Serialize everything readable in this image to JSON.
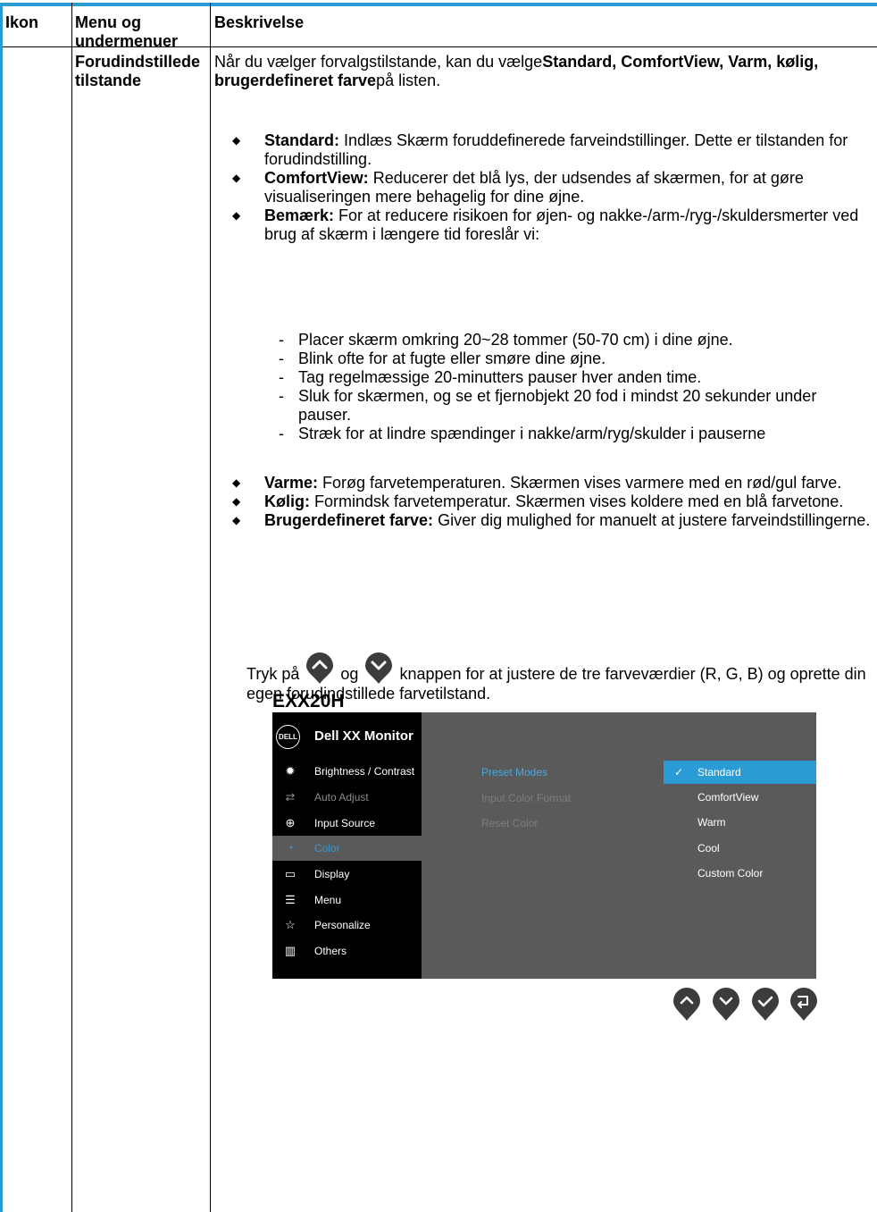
{
  "header": {
    "col1": "Ikon",
    "col2": "Menu og undermenuer",
    "col3": "Beskrivelse"
  },
  "row": {
    "menu": "Forudindstillede tilstande",
    "intro": {
      "part1": "Når du vælger forvalgstilstande, kan du vælge",
      "bold": "Standard, ComfortView, Varm, kølig, brugerdefineret farve",
      "part2": "på listen."
    },
    "bullets_a": [
      {
        "term": "Standard:",
        "text": " Indlæs Skærm foruddefinerede farveindstillinger. Dette er tilstanden for forudindstilling."
      },
      {
        "term": "ComfortView:",
        "text": " Reducerer det blå lys, der udsendes af skærmen, for at gøre visualiseringen mere behagelig for dine øjne."
      },
      {
        "term": "Bemærk:",
        "text": " For at reducere risikoen for øjen- og nakke-/arm-/ryg-/skuldersmerter ved brug af skærm i længere tid foreslår vi:"
      }
    ],
    "tips": [
      "Placer skærm omkring 20~28 tommer (50-70 cm) i dine øjne.",
      "Blink ofte for at fugte eller smøre dine øjne.",
      "Tag regelmæssige 20-minutters pauser hver anden time.",
      "Sluk for skærmen, og se et fjernobjekt 20 fod i mindst 20 sekunder under pauser.",
      "Stræk for at lindre spændinger i nakke/arm/ryg/skulder i pauserne"
    ],
    "bullets_b": [
      {
        "term": "Varme:",
        "text": " Forøg farvetemperaturen. Skærmen vises varmere med en rød/gul farve."
      },
      {
        "term": "Kølig:",
        "text": " Formindsk farvetemperatur. Skærmen vises koldere med en blå farvetone."
      },
      {
        "term": "Brugerdefineret farve:",
        "text": " Giver dig mulighed for manuelt at justere farveindstillingerne."
      }
    ],
    "tryk": {
      "a": "Tryk på",
      "b": "og",
      "c": "knappen for at justere de tre farveværdier (R, G, B) og oprette din egen forudindstillede farvetilstand."
    },
    "model": "EXX20H"
  },
  "osd": {
    "logo": "DELL",
    "title": "Dell XX Monitor",
    "menu": [
      {
        "icon": "brightness-icon",
        "label": "Brightness / Contrast",
        "state": "normal"
      },
      {
        "icon": "auto-adjust-icon",
        "label": "Auto Adjust",
        "state": "dim"
      },
      {
        "icon": "input-source-icon",
        "label": "Input Source",
        "state": "normal"
      },
      {
        "icon": "color-icon",
        "label": "Color",
        "state": "selected"
      },
      {
        "icon": "display-icon",
        "label": "Display",
        "state": "normal"
      },
      {
        "icon": "menu-icon",
        "label": "Menu",
        "state": "normal"
      },
      {
        "icon": "personalize-icon",
        "label": "Personalize",
        "state": "normal"
      },
      {
        "icon": "others-icon",
        "label": "Others",
        "state": "normal"
      }
    ],
    "submenu": [
      "Preset Modes",
      "Input Color Format",
      "Reset Color"
    ],
    "options": [
      "Standard",
      "ComfortView",
      "Warm",
      "Cool",
      "Custom Color"
    ],
    "selected_option": "Standard",
    "nav_buttons": [
      "up-button-icon",
      "down-button-icon",
      "check-button-icon",
      "back-button-icon"
    ],
    "colors": {
      "accent": "#2b9bd6",
      "panel": "#5a5a5a",
      "sidebar": "#000000"
    }
  }
}
